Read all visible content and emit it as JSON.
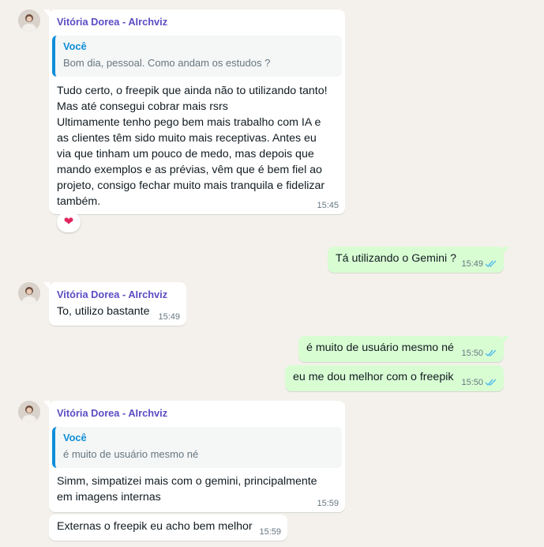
{
  "contact": {
    "name": "Vitória Dorea - AIrchviz"
  },
  "colors": {
    "incoming_bg": "#ffffff",
    "outgoing_bg": "#d9fdd3",
    "sender": "#5b4cc4",
    "quote_accent": "#0f8fd8",
    "read_ticks": "#53bdeb"
  },
  "messages": [
    {
      "direction": "in",
      "sender": "Vitória Dorea - AIrchviz",
      "quote": {
        "author": "Você",
        "text": "Bom dia, pessoal. Como andam os estudos ?"
      },
      "text": "Tudo certo, o freepik que ainda não to utilizando tanto!\nMas até consegui cobrar mais rsrs\nUltimamente tenho pego bem mais trabalho com IA e\nas clientes têm sido muito mais receptivas. Antes eu\nvia que tinham um pouco de medo, mas depois que\nmando exemplos e as prévias, vêm que é bem fiel ao\nprojeto, consigo fechar muito mais tranquila e fidelizar\ntambém.",
      "time": "15:45",
      "reaction": "❤"
    },
    {
      "direction": "out",
      "text": "Tá utilizando o Gemini ?",
      "time": "15:49",
      "status": "read"
    },
    {
      "direction": "in",
      "sender": "Vitória Dorea - AIrchviz",
      "text": "To, utilizo bastante",
      "time": "15:49"
    },
    {
      "direction": "out",
      "text": "é muito de usuário mesmo né",
      "time": "15:50",
      "status": "read"
    },
    {
      "direction": "out",
      "text": "eu me dou melhor com o freepik",
      "time": "15:50",
      "status": "read"
    },
    {
      "direction": "in",
      "sender": "Vitória Dorea - AIrchviz",
      "quote": {
        "author": "Você",
        "text": "é muito de usuário mesmo né"
      },
      "text": "Simm, simpatizei mais com o gemini, principalmente\nem imagens internas",
      "time": "15:59"
    },
    {
      "direction": "in",
      "text": "Externas o freepik eu acho bem melhor",
      "time": "15:59"
    }
  ]
}
